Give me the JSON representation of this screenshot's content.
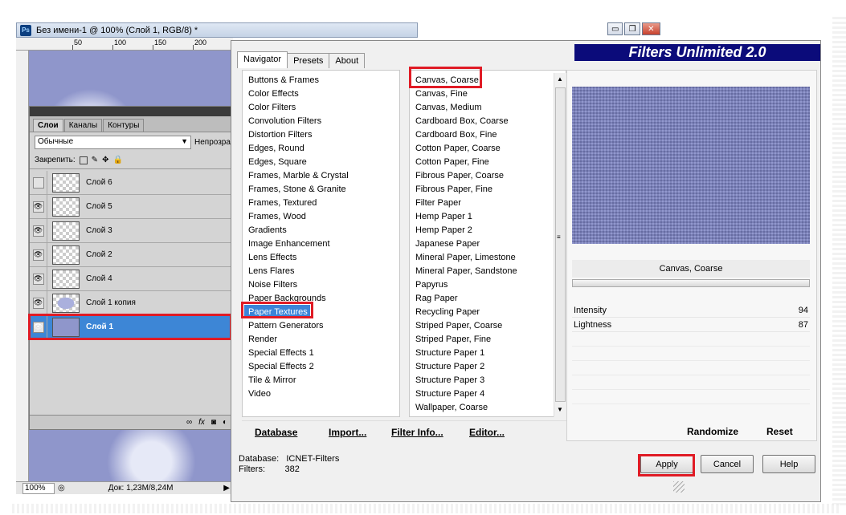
{
  "photoshop": {
    "logo": "Ps",
    "doc_title": "Без имени-1 @ 100% (Слой 1, RGB/8) *",
    "ruler_h": [
      "0",
      "50",
      "100",
      "150",
      "200"
    ],
    "ruler_v": [
      "5",
      "0",
      "5",
      "0",
      "1",
      "0",
      "0",
      "1",
      "5",
      "0",
      "2",
      "0",
      "0",
      "2",
      "5",
      "0",
      "3",
      "0",
      "0",
      "3",
      "5",
      "0",
      "4",
      "0",
      "0",
      "4",
      "5",
      "0",
      "5",
      "0",
      "0"
    ],
    "layers_panel": {
      "tabs": [
        "Слои",
        "Каналы",
        "Контуры"
      ],
      "blend_mode": "Обычные",
      "opacity_label": "Непрозра",
      "lock_label": "Закрепить:",
      "layers": [
        {
          "name": "Слой 6",
          "visible": false
        },
        {
          "name": "Слой 5",
          "visible": true
        },
        {
          "name": "Слой 3",
          "visible": true
        },
        {
          "name": "Слой 2",
          "visible": true
        },
        {
          "name": "Слой 4",
          "visible": true
        },
        {
          "name": "Слой 1 копия",
          "visible": true
        },
        {
          "name": "Слой 1",
          "visible": true,
          "selected": true
        }
      ]
    },
    "status": {
      "zoom": "100%",
      "doc_size": "Док: 1,23M/8,24M"
    }
  },
  "dialog": {
    "logo": "Filters Unlimited 2.0",
    "tabs": [
      "Navigator",
      "Presets",
      "About"
    ],
    "active_tab": "Navigator",
    "categories": [
      "Buttons & Frames",
      "Color Effects",
      "Color Filters",
      "Convolution Filters",
      "Distortion Filters",
      "Edges, Round",
      "Edges, Square",
      "Frames, Marble & Crystal",
      "Frames, Stone & Granite",
      "Frames, Textured",
      "Frames, Wood",
      "Gradients",
      "Image Enhancement",
      "Lens Effects",
      "Lens Flares",
      "Noise Filters",
      "Paper Backgrounds",
      "Paper Textures",
      "Pattern Generators",
      "Render",
      "Special Effects 1",
      "Special Effects 2",
      "Tile & Mirror",
      "Video"
    ],
    "selected_category": "Paper Textures",
    "filters": [
      "Canvas, Coarse",
      "Canvas, Fine",
      "Canvas, Medium",
      "Cardboard Box, Coarse",
      "Cardboard Box, Fine",
      "Cotton Paper, Coarse",
      "Cotton Paper, Fine",
      "Fibrous Paper, Coarse",
      "Fibrous Paper, Fine",
      "Filter Paper",
      "Hemp Paper 1",
      "Hemp Paper 2",
      "Japanese Paper",
      "Mineral Paper, Limestone",
      "Mineral Paper, Sandstone",
      "Papyrus",
      "Rag Paper",
      "Recycling Paper",
      "Striped Paper, Coarse",
      "Striped Paper, Fine",
      "Structure Paper 1",
      "Structure Paper 2",
      "Structure Paper 3",
      "Structure Paper 4",
      "Wallpaper, Coarse"
    ],
    "selected_filter": "Canvas, Coarse",
    "current_filter_name": "Canvas, Coarse",
    "params": [
      {
        "label": "Intensity",
        "value": "94"
      },
      {
        "label": "Lightness",
        "value": "87"
      }
    ],
    "strip_buttons": [
      "Database",
      "Import...",
      "Filter Info...",
      "Editor..."
    ],
    "randomize": "Randomize",
    "reset": "Reset",
    "db_label": "Database:",
    "db_value": "ICNET-Filters",
    "filters_label": "Filters:",
    "filters_count": "382",
    "apply": "Apply",
    "cancel": "Cancel",
    "help": "Help",
    "preview_color": "#7c82c4"
  },
  "window_buttons": {
    "minimize": "▭",
    "restore": "❐",
    "close": "✕"
  },
  "highlight_color": "#e01b25"
}
